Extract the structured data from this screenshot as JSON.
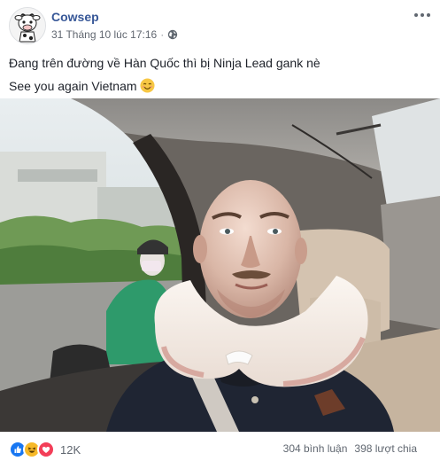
{
  "post": {
    "author": "Cowsep",
    "timestamp": "31 Tháng 10 lúc 17:16",
    "separator": "·",
    "privacy_icon": "globe-icon",
    "more_icon": "more-options-icon",
    "text_line1": "Đang trên đường về Hàn Quốc thì bị Ninja Lead gank nè",
    "text_line2": "See you again Vietnam",
    "emoji": "smiling-face-emoji"
  },
  "reactions": {
    "icons": [
      "like-icon",
      "haha-icon",
      "love-icon"
    ],
    "count": "12K",
    "comments": "304 bình luận",
    "shares": "398 lượt chia"
  },
  "colors": {
    "author_link": "#385898",
    "like": "#1877f2",
    "haha": "#f7b928",
    "love": "#f33e58"
  }
}
